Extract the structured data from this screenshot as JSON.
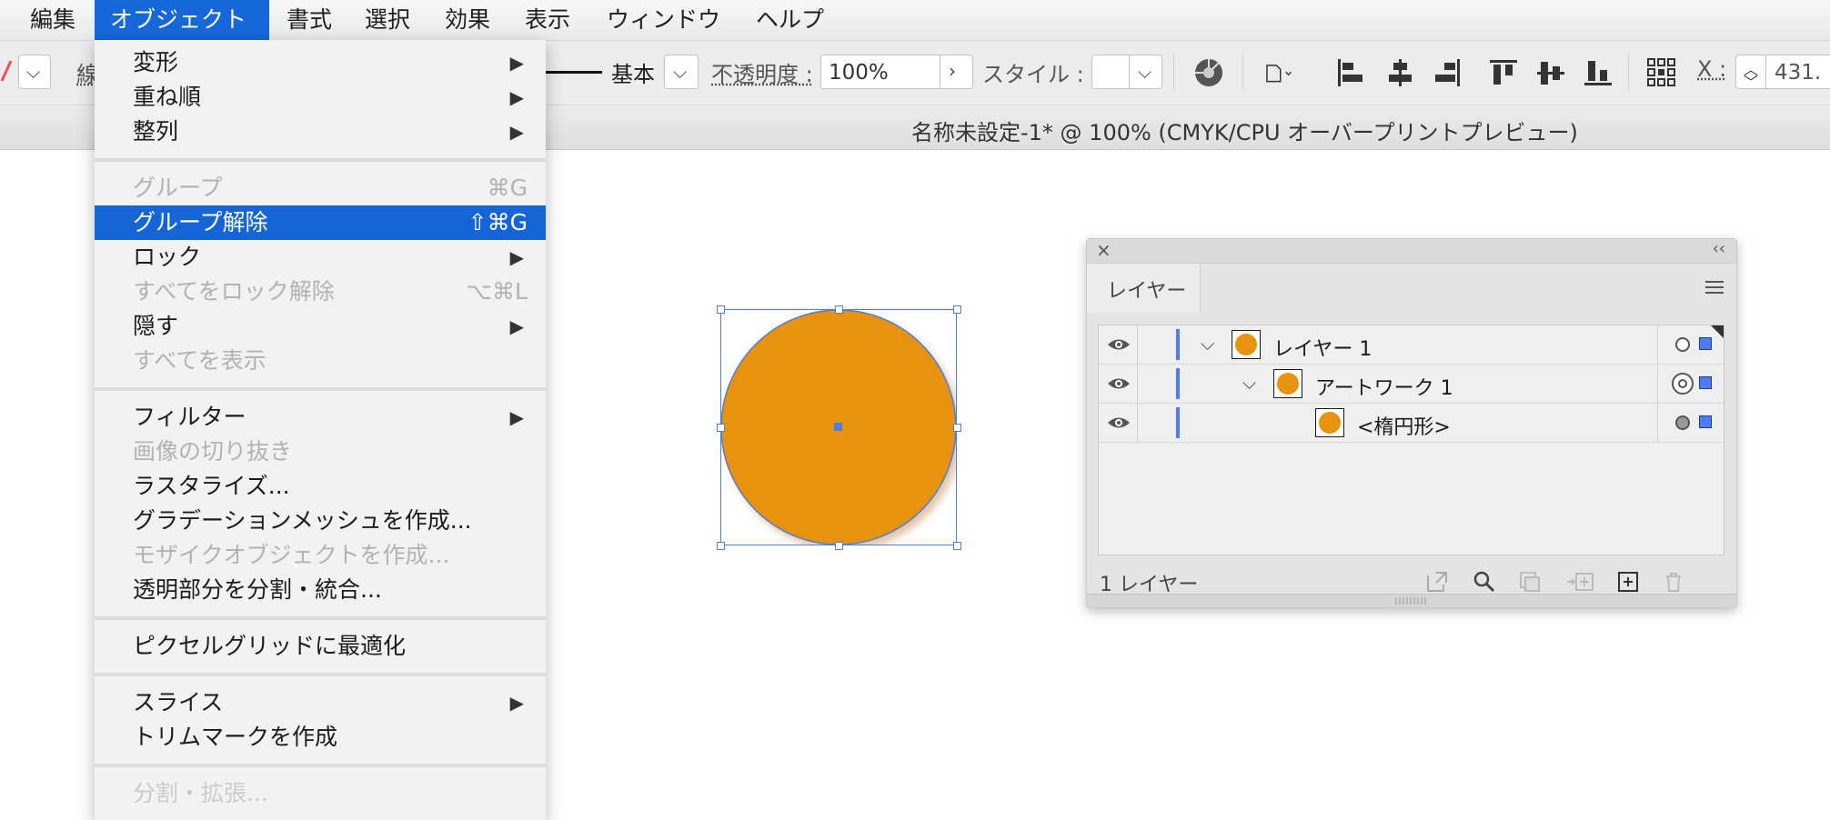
{
  "menubar": {
    "items": [
      {
        "label": "編集"
      },
      {
        "label": "オブジェクト",
        "active": true
      },
      {
        "label": "書式"
      },
      {
        "label": "選択"
      },
      {
        "label": "効果"
      },
      {
        "label": "表示"
      },
      {
        "label": "ウィンドウ"
      },
      {
        "label": "ヘルプ"
      }
    ]
  },
  "controlbar": {
    "stroke_label_partial": "線",
    "brush_label": "基本",
    "opacity_label": "不透明度 :",
    "opacity_value": "100%",
    "style_label": "スタイル :",
    "x_label": "X :",
    "x_value": "431."
  },
  "document": {
    "title": "名称未設定-1* @ 100% (CMYK/CPU オーバープリントプレビュー)"
  },
  "object_menu": {
    "items": [
      {
        "label": "変形",
        "submenu": true
      },
      {
        "label": "重ね順",
        "submenu": true
      },
      {
        "label": "整列",
        "submenu": true
      },
      {
        "label": "グループ",
        "shortcut": "⌘G",
        "disabled": true
      },
      {
        "label": "グループ解除",
        "shortcut": "⇧⌘G",
        "highlighted": true
      },
      {
        "label": "ロック",
        "submenu": true
      },
      {
        "label": "すべてをロック解除",
        "shortcut": "⌥⌘L",
        "disabled": true
      },
      {
        "label": "隠す",
        "submenu": true
      },
      {
        "label": "すべてを表示",
        "disabled": true
      },
      {
        "label": "フィルター",
        "submenu": true
      },
      {
        "label": "画像の切り抜き",
        "disabled": true
      },
      {
        "label": "ラスタライズ..."
      },
      {
        "label": "グラデーションメッシュを作成..."
      },
      {
        "label": "モザイクオブジェクトを作成...",
        "disabled": true
      },
      {
        "label": "透明部分を分割・統合..."
      },
      {
        "label": "ピクセルグリッドに最適化"
      },
      {
        "label": "スライス",
        "submenu": true
      },
      {
        "label": "トリムマークを作成"
      },
      {
        "label": "分割・拡張...",
        "disabled": true
      }
    ]
  },
  "artwork": {
    "fill_color": "#E8920F",
    "selection_color": "#4A7FE0"
  },
  "layers_panel": {
    "tab_label": "レイヤー",
    "rows": [
      {
        "name": "レイヤー 1",
        "expanded": true,
        "target": "empty"
      },
      {
        "name": "アートワーク 1",
        "expanded": true,
        "target": "double"
      },
      {
        "name": "<楕円形>",
        "target": "filled"
      }
    ],
    "footer_count": "1 レイヤー"
  },
  "colors": {
    "menu_highlight": "#1565D6",
    "layer_color": "#4C7CF0"
  }
}
